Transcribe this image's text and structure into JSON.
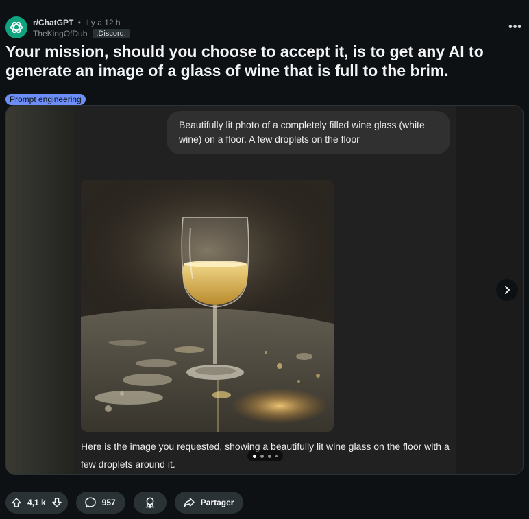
{
  "post": {
    "subreddit": "r/ChatGPT",
    "separator": "•",
    "time": "il y a 12 h",
    "author": "TheKingOfDub",
    "author_flair": ":Discord:",
    "more_label": "•••",
    "title": "Your mission, should you choose to accept it, is to get any AI to generate an image of a glass of wine that is full to the brim.",
    "post_flair": "Prompt engineering"
  },
  "gallery": {
    "prompt_bubble": "Beautifully lit photo of a completely filled wine glass (white wine) on a floor. A few droplets on the floor",
    "reply_text": "Here is the image you requested, showing a beautifully lit wine glass on the floor with a few droplets around it.",
    "current_slide": 1,
    "total_slides": 4
  },
  "actions": {
    "vote_count": "4,1 k",
    "comment_count": "957",
    "share_label": "Partager"
  },
  "colors": {
    "background": "#0e1113",
    "subreddit_avatar": "#10a37f",
    "post_flair": "#6e8ef7",
    "pill": "#2a3236"
  },
  "icons": {
    "avatar": "openai-logo-icon",
    "upvote": "arrow-up-icon",
    "downvote": "arrow-down-icon",
    "comment": "comment-bubble-icon",
    "award": "award-icon",
    "share": "share-arrow-icon",
    "next": "chevron-right-icon"
  }
}
